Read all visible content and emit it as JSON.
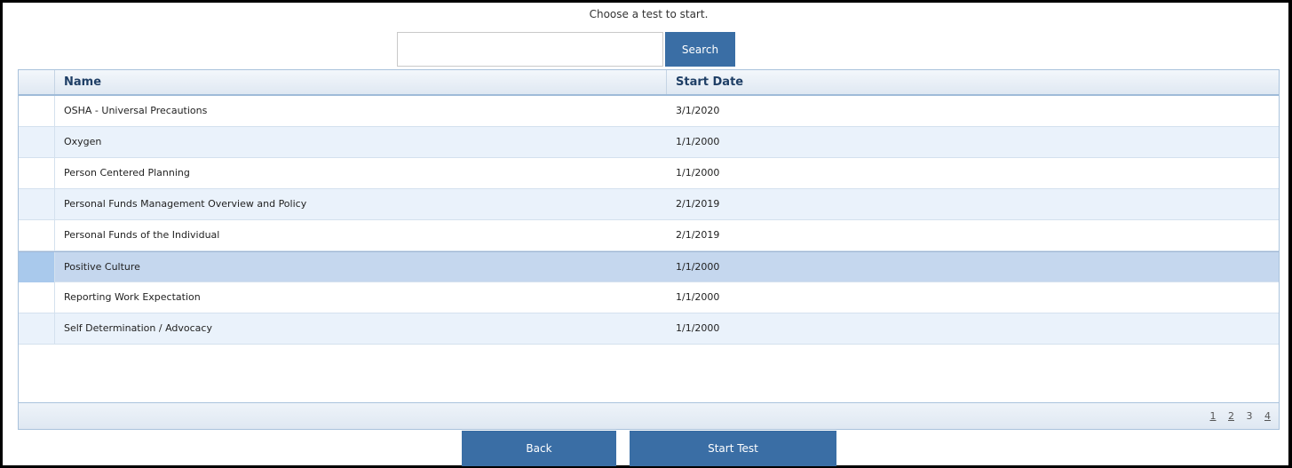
{
  "prompt": "Choose a test to start.",
  "search": {
    "placeholder": "",
    "value": "",
    "button_label": "Search"
  },
  "grid": {
    "columns": {
      "name": "Name",
      "start_date": "Start Date"
    },
    "rows": [
      {
        "name": "OSHA - Universal Precautions",
        "start_date": "3/1/2020"
      },
      {
        "name": "Oxygen",
        "start_date": "1/1/2000"
      },
      {
        "name": "Person Centered Planning",
        "start_date": "1/1/2000"
      },
      {
        "name": "Personal Funds Management Overview and Policy",
        "start_date": "2/1/2019"
      },
      {
        "name": "Personal Funds of the Individual",
        "start_date": "2/1/2019"
      },
      {
        "name": "Positive Culture",
        "start_date": "1/1/2000"
      },
      {
        "name": "Reporting Work Expectation",
        "start_date": "1/1/2000"
      },
      {
        "name": "Self Determination / Advocacy",
        "start_date": "1/1/2000"
      }
    ],
    "selected_row": 5
  },
  "pager": {
    "pages": [
      "1",
      "2",
      "3",
      "4"
    ],
    "current": "3"
  },
  "buttons": {
    "back": "Back",
    "start_test": "Start Test"
  },
  "colors": {
    "button": "#3a6ea5",
    "selected_row": "#c5d7ee",
    "alt_row": "#eaf2fb"
  }
}
